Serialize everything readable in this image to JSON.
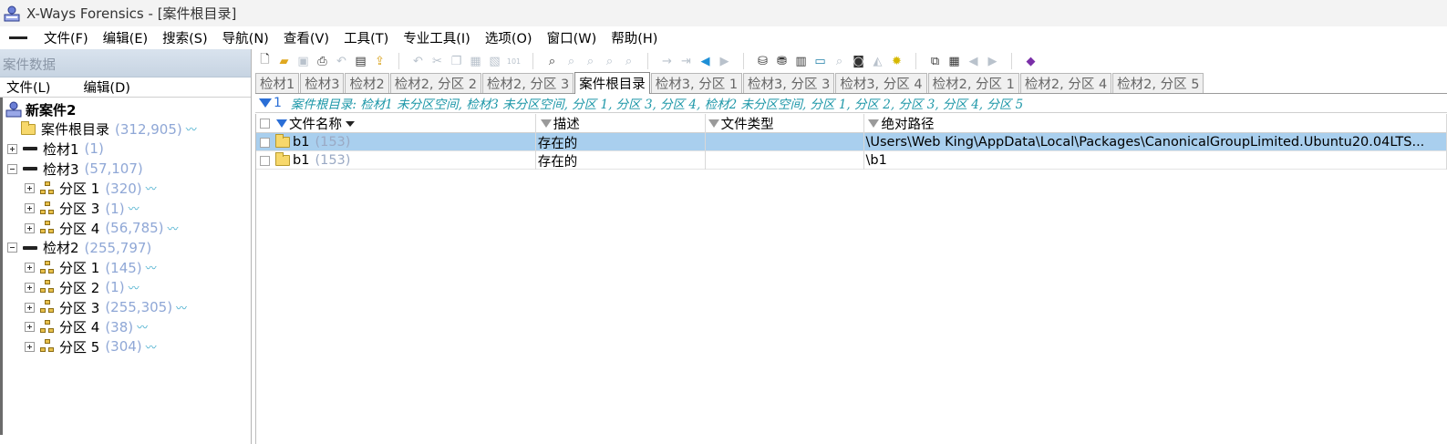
{
  "window": {
    "title": "X-Ways Forensics - [案件根目录]"
  },
  "menu": [
    "文件(F)",
    "编辑(E)",
    "搜索(S)",
    "导航(N)",
    "查看(V)",
    "工具(T)",
    "专业工具(I)",
    "选项(O)",
    "窗口(W)",
    "帮助(H)"
  ],
  "left_pane": {
    "header": "案件数据",
    "menu": [
      "文件(L)",
      "编辑(D)"
    ],
    "tree": [
      {
        "label": "新案件2",
        "count": "",
        "bold": true,
        "icon": "case-icon",
        "level": 0,
        "expander": "none"
      },
      {
        "label": "案件根目录",
        "count": "(312,905)",
        "icon": "folder-icon",
        "level": 1,
        "expander": "none",
        "squiggle": true
      },
      {
        "label": "检材1",
        "count": "(1)",
        "icon": "disk-icon",
        "level": 0,
        "expander": "plus"
      },
      {
        "label": "检材3",
        "count": "(57,107)",
        "icon": "disk-icon",
        "level": 0,
        "expander": "minus"
      },
      {
        "label": "分区 1",
        "count": "(320)",
        "icon": "partition-icon",
        "level": 1,
        "expander": "plus",
        "squiggle": true
      },
      {
        "label": "分区 3",
        "count": "(1)",
        "icon": "partition-icon",
        "level": 1,
        "expander": "plus",
        "squiggle": true
      },
      {
        "label": "分区 4",
        "count": "(56,785)",
        "icon": "partition-icon",
        "level": 1,
        "expander": "plus",
        "squiggle": true
      },
      {
        "label": "检材2",
        "count": "(255,797)",
        "icon": "disk-icon",
        "level": 0,
        "expander": "minus"
      },
      {
        "label": "分区 1",
        "count": "(145)",
        "icon": "partition-icon",
        "level": 1,
        "expander": "plus",
        "squiggle": true
      },
      {
        "label": "分区 2",
        "count": "(1)",
        "icon": "partition-icon",
        "level": 1,
        "expander": "plus",
        "squiggle": true
      },
      {
        "label": "分区 3",
        "count": "(255,305)",
        "icon": "partition-icon",
        "level": 1,
        "expander": "plus",
        "squiggle": true
      },
      {
        "label": "分区 4",
        "count": "(38)",
        "icon": "partition-icon",
        "level": 1,
        "expander": "plus",
        "squiggle": true
      },
      {
        "label": "分区 5",
        "count": "(304)",
        "icon": "partition-icon",
        "level": 1,
        "expander": "plus",
        "squiggle": true
      }
    ]
  },
  "tabs": [
    {
      "label": "检材1",
      "active": false
    },
    {
      "label": "检材3",
      "active": false
    },
    {
      "label": "检材2",
      "active": false
    },
    {
      "label": "检材2, 分区 2",
      "active": false
    },
    {
      "label": "检材2, 分区 3",
      "active": false
    },
    {
      "label": "案件根目录",
      "active": true
    },
    {
      "label": "检材3, 分区 1",
      "active": false
    },
    {
      "label": "检材3, 分区 3",
      "active": false
    },
    {
      "label": "检材3, 分区 4",
      "active": false
    },
    {
      "label": "检材2, 分区 1",
      "active": false
    },
    {
      "label": "检材2, 分区 4",
      "active": false
    },
    {
      "label": "检材2, 分区 5",
      "active": false
    }
  ],
  "filter_bar": {
    "count": "1",
    "text": "案件根目录: 检材1 未分区空间, 检材3 未分区空间, 分区 1, 分区 3, 分区 4, 检材2 未分区空间, 分区 1, 分区 2, 分区 3, 分区 4, 分区 5"
  },
  "table": {
    "columns": [
      "文件名称",
      "描述",
      "文件类型",
      "绝对路径"
    ],
    "rows": [
      {
        "name": "b1",
        "count": "(153)",
        "description": "存在的",
        "type": "",
        "path": "\\Users\\Web King\\AppData\\Local\\Packages\\CanonicalGroupLimited.Ubuntu20.04LTS...",
        "selected": true
      },
      {
        "name": "b1",
        "count": "(153)",
        "description": "存在的",
        "type": "",
        "path": "\\b1",
        "selected": false
      }
    ]
  },
  "colors": {
    "selection": "#a9cfee",
    "count_text": "#8fa7d6",
    "filter_text": "#1d97a8",
    "filter_icon": "#2a6ed6"
  }
}
